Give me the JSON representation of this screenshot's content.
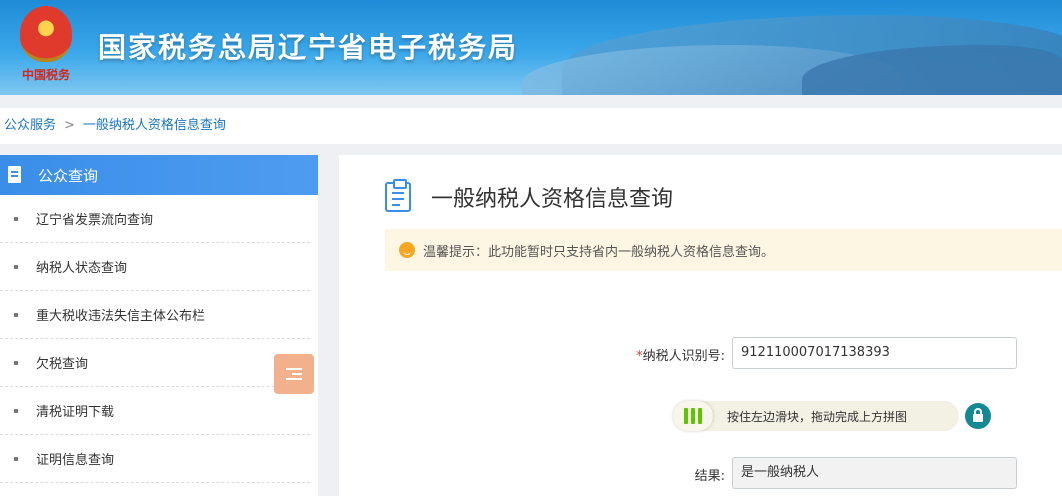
{
  "header": {
    "emblem_text": "中国税务",
    "site_title": "国家税务总局辽宁省电子税务局"
  },
  "breadcrumb": {
    "root": "公众服务",
    "separator": ">",
    "current": "一般纳税人资格信息查询"
  },
  "sidebar": {
    "title": "公众查询",
    "items": [
      {
        "label": "辽宁省发票流向查询"
      },
      {
        "label": "纳税人状态查询"
      },
      {
        "label": "重大税收违法失信主体公布栏"
      },
      {
        "label": "欠税查询"
      },
      {
        "label": "清税证明下载"
      },
      {
        "label": "证明信息查询"
      }
    ]
  },
  "main": {
    "title": "一般纳税人资格信息查询",
    "notice": "温馨提示：此功能暂时只支持省内一般纳税人资格信息查询。",
    "form": {
      "id_required_mark": "*",
      "id_label": "纳税人识别号:",
      "id_value": "912110007017138393",
      "slider_text": "按住左边滑块，拖动完成上方拼图",
      "result_label": "结果:",
      "result_value": "是一般纳税人"
    }
  },
  "colors": {
    "accent": "#3a8ee8",
    "link": "#1a76c0",
    "notice_bg": "#fdf6e3",
    "required": "#e4393c",
    "slider_knob": "#5cc400",
    "lock": "#138a93"
  }
}
